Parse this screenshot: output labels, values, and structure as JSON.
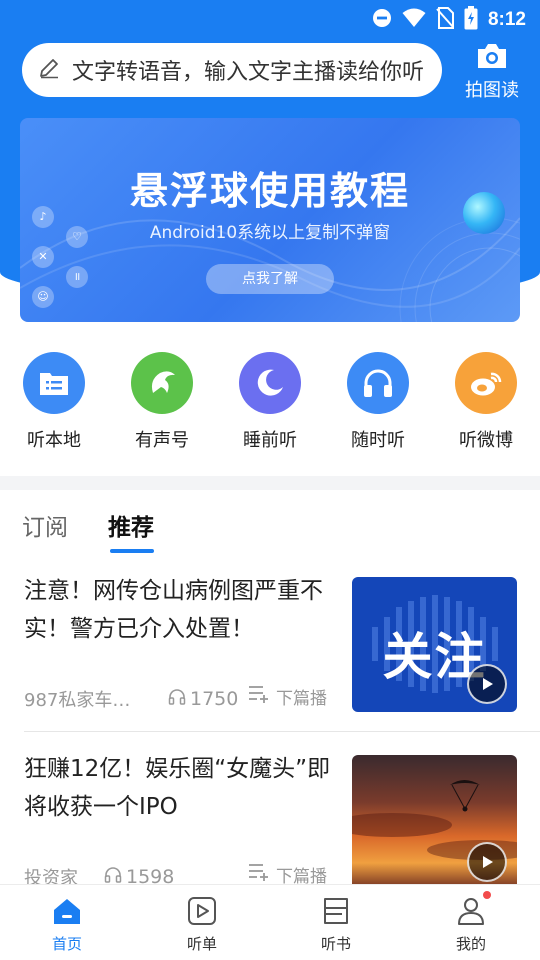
{
  "status_bar": {
    "time": "8:12"
  },
  "search": {
    "placeholder": "文字转语音，输入文字主播读给你听"
  },
  "photo_read": {
    "label": "拍图读"
  },
  "banner": {
    "title": "悬浮球使用教程",
    "subtitle": "Android10系统以上复制不弹窗",
    "button": "点我了解"
  },
  "categories": [
    {
      "label": "听本地",
      "color": "#3d8bf5",
      "icon": "folder-list-icon"
    },
    {
      "label": "有声号",
      "color": "#5cc24a",
      "icon": "dolphin-icon"
    },
    {
      "label": "睡前听",
      "color": "#6b6ff0",
      "icon": "moon-icon"
    },
    {
      "label": "随时听",
      "color": "#3d8bf5",
      "icon": "headphones-icon"
    },
    {
      "label": "听微博",
      "color": "#f7a23a",
      "icon": "weibo-icon"
    }
  ],
  "tabs": {
    "subscribe": "订阅",
    "recommend": "推荐"
  },
  "articles": [
    {
      "title": "注意！网传仓山病例图严重不实！警方已介入处置！",
      "source": "987私家车…",
      "plays": "1750",
      "next_label": "下篇播",
      "thumb_text": "关注"
    },
    {
      "title": "狂赚12亿！娱乐圈“女魔头”即将收获一个IPO",
      "source": "投资家",
      "plays": "1598",
      "next_label": "下篇播"
    }
  ],
  "bottom_nav": [
    {
      "label": "首页",
      "icon": "home-icon",
      "active": true
    },
    {
      "label": "听单",
      "icon": "play-list-icon"
    },
    {
      "label": "听书",
      "icon": "book-icon"
    },
    {
      "label": "我的",
      "icon": "user-icon"
    }
  ],
  "colors": {
    "accent": "#1a7ef2",
    "header_bg": "#1a7ef2",
    "badge_red": "#f24b4b"
  }
}
